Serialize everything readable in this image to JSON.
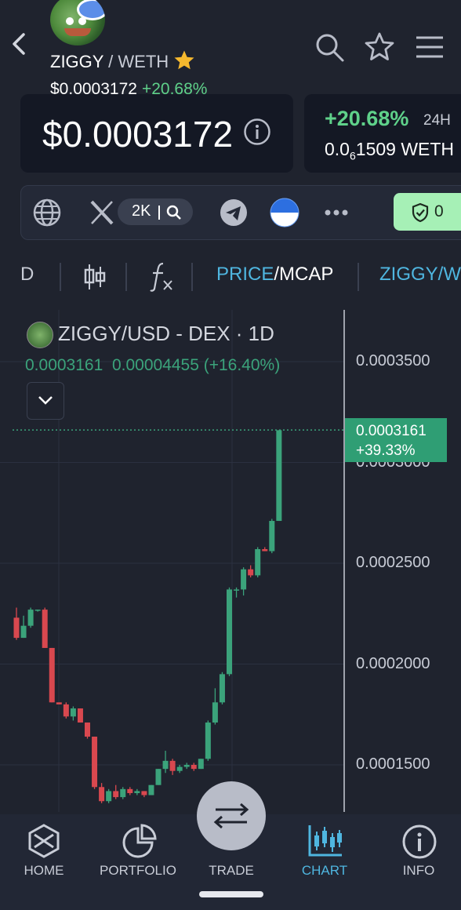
{
  "header": {
    "token": "ZIGGY",
    "quote": "WETH",
    "price": "$0.0003172",
    "change": "+20.68%"
  },
  "price_card": {
    "price": "$0.0003172"
  },
  "change_card": {
    "change": "+20.68%",
    "period": "24H",
    "weth_prefix": "0.0",
    "weth_sub": "6",
    "weth_rest": "1509 WETH"
  },
  "social": {
    "x_followers": "2K",
    "shield_count": "0"
  },
  "toolbar": {
    "interval": "D",
    "price_label": "PRICE",
    "slash": "/",
    "mcap_label": "MCAP",
    "pair_partial": "ZIGGY/W"
  },
  "chart_legend": {
    "title": "ZIGGY/USD - DEX · 1D",
    "last": "0.0003161",
    "change": "0.00004455 (+16.40%)"
  },
  "price_tag": {
    "price": "0.0003161",
    "pct": "+39.33%"
  },
  "nav": {
    "home": "HOME",
    "portfolio": "PORTFOLIO",
    "trade": "TRADE",
    "chart": "CHART",
    "info": "INFO"
  },
  "colors": {
    "up": "#3ba37b",
    "down": "#d9484f",
    "accent": "#4fb6e0"
  },
  "chart_data": {
    "type": "candlestick",
    "title": "ZIGGY/USD - DEX · 1D",
    "y_ticks": [
      "0.0003500",
      "0.0003000",
      "0.0002500",
      "0.0002000",
      "0.0001500"
    ],
    "ylim": [
      0.00013,
      0.00038
    ],
    "last_price": 0.0003161,
    "candles": [
      {
        "o": 0.000223,
        "h": 0.000228,
        "l": 0.000212,
        "c": 0.000213
      },
      {
        "o": 0.000213,
        "h": 0.000224,
        "l": 0.000213,
        "c": 0.000219
      },
      {
        "o": 0.000219,
        "h": 0.000228,
        "l": 0.000218,
        "c": 0.000227
      },
      {
        "o": 0.000227,
        "h": 0.000227,
        "l": 0.000226,
        "c": 0.000227
      },
      {
        "o": 0.000227,
        "h": 0.000228,
        "l": 0.000208,
        "c": 0.000208
      },
      {
        "o": 0.000208,
        "h": 0.000208,
        "l": 0.000181,
        "c": 0.000181
      },
      {
        "o": 0.000181,
        "h": 0.000181,
        "l": 0.00018,
        "c": 0.00018
      },
      {
        "o": 0.00018,
        "h": 0.000181,
        "l": 0.000173,
        "c": 0.000174
      },
      {
        "o": 0.000174,
        "h": 0.000179,
        "l": 0.000172,
        "c": 0.000178
      },
      {
        "o": 0.000178,
        "h": 0.000178,
        "l": 0.000171,
        "c": 0.000171
      },
      {
        "o": 0.000171,
        "h": 0.000171,
        "l": 0.000163,
        "c": 0.000164
      },
      {
        "o": 0.000164,
        "h": 0.000164,
        "l": 0.000138,
        "c": 0.000139
      },
      {
        "o": 0.000139,
        "h": 0.000141,
        "l": 0.000131,
        "c": 0.000132
      },
      {
        "o": 0.000132,
        "h": 0.000138,
        "l": 0.000131,
        "c": 0.000137
      },
      {
        "o": 0.000137,
        "h": 0.00014,
        "l": 0.000133,
        "c": 0.000134
      },
      {
        "o": 0.000134,
        "h": 0.000139,
        "l": 0.000133,
        "c": 0.000138
      },
      {
        "o": 0.000138,
        "h": 0.000139,
        "l": 0.000135,
        "c": 0.000136
      },
      {
        "o": 0.000136,
        "h": 0.000138,
        "l": 0.000135,
        "c": 0.000137
      },
      {
        "o": 0.000137,
        "h": 0.000137,
        "l": 0.000134,
        "c": 0.000135
      },
      {
        "o": 0.000135,
        "h": 0.00014,
        "l": 0.000135,
        "c": 0.00014
      },
      {
        "o": 0.00014,
        "h": 0.000148,
        "l": 0.00014,
        "c": 0.000148
      },
      {
        "o": 0.000148,
        "h": 0.000157,
        "l": 0.000146,
        "c": 0.000152
      },
      {
        "o": 0.000152,
        "h": 0.000153,
        "l": 0.000145,
        "c": 0.000147
      },
      {
        "o": 0.000147,
        "h": 0.00015,
        "l": 0.000146,
        "c": 0.000149
      },
      {
        "o": 0.000149,
        "h": 0.000151,
        "l": 0.000148,
        "c": 0.00015
      },
      {
        "o": 0.00015,
        "h": 0.000151,
        "l": 0.000147,
        "c": 0.000148
      },
      {
        "o": 0.000148,
        "h": 0.000153,
        "l": 0.000148,
        "c": 0.000153
      },
      {
        "o": 0.000153,
        "h": 0.000172,
        "l": 0.000152,
        "c": 0.000171
      },
      {
        "o": 0.000171,
        "h": 0.000188,
        "l": 0.00017,
        "c": 0.000181
      },
      {
        "o": 0.000181,
        "h": 0.000196,
        "l": 0.00018,
        "c": 0.000195
      },
      {
        "o": 0.000195,
        "h": 0.000238,
        "l": 0.000194,
        "c": 0.000237
      },
      {
        "o": 0.000237,
        "h": 0.000238,
        "l": 0.000233,
        "c": 0.000237
      },
      {
        "o": 0.000237,
        "h": 0.000248,
        "l": 0.000234,
        "c": 0.000247
      },
      {
        "o": 0.000247,
        "h": 0.000249,
        "l": 0.000243,
        "c": 0.000244
      },
      {
        "o": 0.000244,
        "h": 0.000258,
        "l": 0.000243,
        "c": 0.000257
      },
      {
        "o": 0.000257,
        "h": 0.000258,
        "l": 0.000256,
        "c": 0.000256
      },
      {
        "o": 0.000256,
        "h": 0.000272,
        "l": 0.000255,
        "c": 0.000271
      },
      {
        "o": 0.000271,
        "h": 0.000316,
        "l": 0.000271,
        "c": 0.000316
      }
    ]
  }
}
